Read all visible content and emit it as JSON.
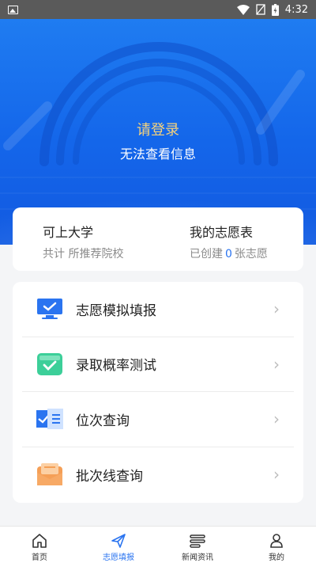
{
  "status_bar": {
    "time": "4:32"
  },
  "hero": {
    "login_label": "请登录",
    "subtitle": "无法查看信息"
  },
  "info": {
    "left": {
      "title": "可上大学",
      "prefix": "共计",
      "suffix": "所推荐院校"
    },
    "right": {
      "title": "我的志愿表",
      "prefix": "已创建",
      "count": "0",
      "suffix": "张志愿"
    }
  },
  "menu": [
    {
      "label": "志愿模拟填报",
      "icon": "monitor-check-icon"
    },
    {
      "label": "录取概率测试",
      "icon": "green-check-card-icon"
    },
    {
      "label": "位次查询",
      "icon": "rank-chart-icon"
    },
    {
      "label": "批次线查询",
      "icon": "orange-envelope-icon"
    }
  ],
  "tabs": [
    {
      "label": "首页",
      "icon": "home-icon"
    },
    {
      "label": "志愿填报",
      "icon": "send-icon",
      "active": true
    },
    {
      "label": "新闻资讯",
      "icon": "news-list-icon"
    },
    {
      "label": "我的",
      "icon": "person-icon"
    }
  ],
  "colors": {
    "primary": "#1466ea",
    "accent": "#2a74f0",
    "gold": "#f5d37c"
  }
}
